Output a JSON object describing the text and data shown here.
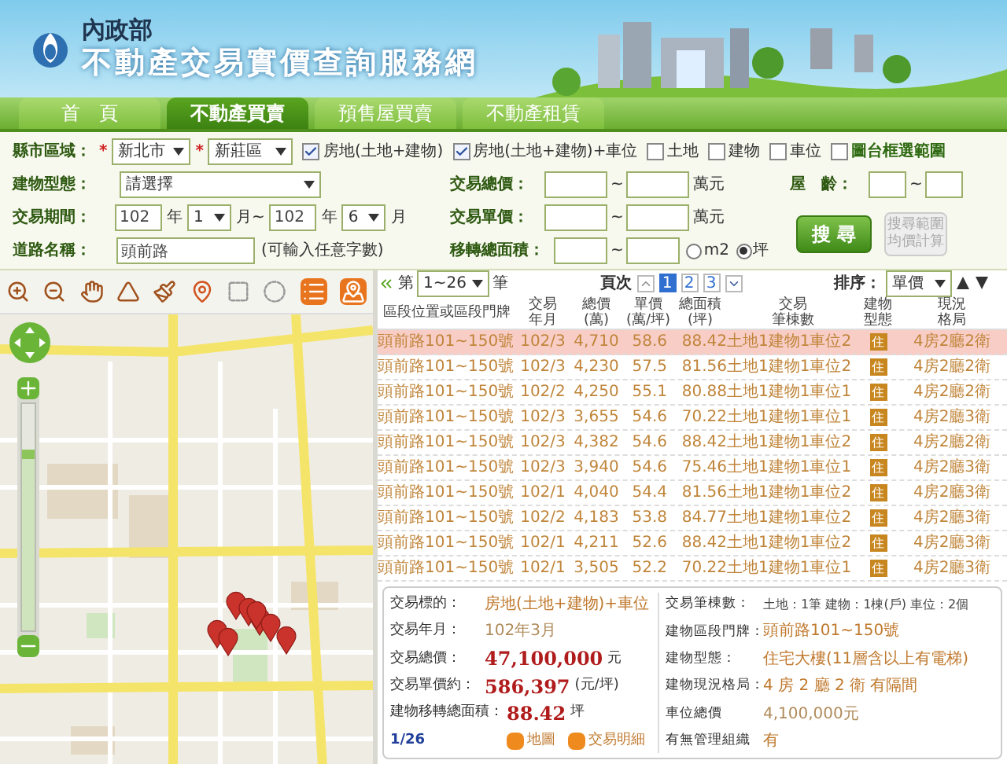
{
  "header": {
    "ministry": "內政部",
    "site_title": "不動產交易實價查詢服務網"
  },
  "tabs": [
    {
      "label": "首　頁",
      "selected": false
    },
    {
      "label": "不動產買賣",
      "selected": true
    },
    {
      "label": "預售屋買賣",
      "selected": false
    },
    {
      "label": "不動產租賃",
      "selected": false
    }
  ],
  "search_form": {
    "region": {
      "label": "縣市區域：",
      "required_mark": "*",
      "city": "新北市",
      "district_required_mark": "*",
      "district": "新莊區"
    },
    "type_filters": [
      {
        "label": "房地(土地+建物)",
        "checked": true,
        "kind": "type"
      },
      {
        "label": "房地(土地+建物)+車位",
        "checked": true,
        "kind": "type"
      },
      {
        "label": "土地",
        "checked": false,
        "kind": "type"
      },
      {
        "label": "建物",
        "checked": false,
        "kind": "type"
      },
      {
        "label": "車位",
        "checked": false,
        "kind": "type"
      },
      {
        "label": "圖台框選範圍",
        "checked": false,
        "kind": "map"
      }
    ],
    "building_type": {
      "label": "建物型態：",
      "value": "請選擇"
    },
    "total_price": {
      "label": "交易總價：",
      "separator": "~",
      "unit": "萬元"
    },
    "age": {
      "label": "屋　齡：",
      "separator": "~"
    },
    "period": {
      "label": "交易期間：",
      "from_year": "102",
      "from_year_unit": "年",
      "from_month": "1",
      "from_month_unit": "月~",
      "to_year": "102",
      "to_year_unit": "年",
      "to_month": "6",
      "to_month_unit": "月"
    },
    "unit_price": {
      "label": "交易單價：",
      "separator": "~",
      "unit": "萬元"
    },
    "road": {
      "label": "道路名稱：",
      "value": "頭前路",
      "hint": "(可輸入任意字數)"
    },
    "area": {
      "label": "移轉總面積：",
      "separator": "~",
      "units": [
        {
          "label": "m2",
          "selected": false
        },
        {
          "label": "坪",
          "selected": true
        }
      ]
    },
    "search_button": "搜 尋",
    "average_button": {
      "label": "搜尋範圍均價計算",
      "disabled": true
    }
  },
  "map": {
    "level": 0.8
  },
  "list": {
    "range_prefix": "第",
    "range": "1~26",
    "range_suffix": "筆",
    "pages_label": "頁次",
    "pages": [
      {
        "label": "1",
        "selected": true
      },
      {
        "label": "2",
        "selected": false
      },
      {
        "label": "3",
        "selected": false
      }
    ],
    "sort_label": "排序：",
    "sort": "單價",
    "columns": [
      [
        "區段位置或區段門牌"
      ],
      [
        "交易",
        "年月"
      ],
      [
        "總價",
        "(萬)"
      ],
      [
        "單價",
        "(萬/坪)"
      ],
      [
        "總面積",
        "(坪)"
      ],
      [
        "交易",
        "筆棟數"
      ],
      [
        "建物",
        "型態"
      ],
      [
        "現況",
        "格局"
      ]
    ],
    "rows": [
      {
        "address": "頭前路101~150號",
        "date": "102/3",
        "total": "4,710",
        "unit_price": "58.6",
        "area": "88.42",
        "counts": "土地1建物1車位2",
        "type": "住",
        "layout": "4房2廳2衛",
        "selected": true
      },
      {
        "address": "頭前路101~150號",
        "date": "102/3",
        "total": "4,230",
        "unit_price": "57.5",
        "area": "81.56",
        "counts": "土地1建物1車位2",
        "type": "住",
        "layout": "4房2廳2衛",
        "selected": false
      },
      {
        "address": "頭前路101~150號",
        "date": "102/2",
        "total": "4,250",
        "unit_price": "55.1",
        "area": "80.88",
        "counts": "土地1建物1車位1",
        "type": "住",
        "layout": "4房2廳2衛",
        "selected": false
      },
      {
        "address": "頭前路101~150號",
        "date": "102/3",
        "total": "3,655",
        "unit_price": "54.6",
        "area": "70.22",
        "counts": "土地1建物1車位1",
        "type": "住",
        "layout": "4房2廳3衛",
        "selected": false
      },
      {
        "address": "頭前路101~150號",
        "date": "102/3",
        "total": "4,382",
        "unit_price": "54.6",
        "area": "88.42",
        "counts": "土地1建物1車位2",
        "type": "住",
        "layout": "4房2廳2衛",
        "selected": false
      },
      {
        "address": "頭前路101~150號",
        "date": "102/3",
        "total": "3,940",
        "unit_price": "54.6",
        "area": "75.46",
        "counts": "土地1建物1車位1",
        "type": "住",
        "layout": "4房2廳3衛",
        "selected": false
      },
      {
        "address": "頭前路101~150號",
        "date": "102/1",
        "total": "4,040",
        "unit_price": "54.4",
        "area": "81.56",
        "counts": "土地1建物1車位2",
        "type": "住",
        "layout": "4房2廳3衛",
        "selected": false
      },
      {
        "address": "頭前路101~150號",
        "date": "102/2",
        "total": "4,183",
        "unit_price": "53.8",
        "area": "84.77",
        "counts": "土地1建物1車位2",
        "type": "住",
        "layout": "4房2廳3衛",
        "selected": false
      },
      {
        "address": "頭前路101~150號",
        "date": "102/1",
        "total": "4,211",
        "unit_price": "52.6",
        "area": "88.42",
        "counts": "土地1建物1車位2",
        "type": "住",
        "layout": "4房2廳3衛",
        "selected": false
      },
      {
        "address": "頭前路101~150號",
        "date": "102/1",
        "total": "3,505",
        "unit_price": "52.2",
        "area": "70.22",
        "counts": "土地1建物1車位1",
        "type": "住",
        "layout": "4房2廳3衛",
        "selected": false
      }
    ]
  },
  "detail": {
    "left": [
      {
        "label": "交易標的：",
        "value": "房地(土地+建物)+車位",
        "kind": "accent"
      },
      {
        "label": "交易年月：",
        "value": "102年3月",
        "kind": "muted"
      },
      {
        "label": "交易總價：",
        "value": "47,100,000",
        "unit": "元",
        "kind": "price"
      },
      {
        "label": "交易單價約：",
        "value": "586,397",
        "unit": "(元/坪)",
        "kind": "price"
      },
      {
        "label": "建物移轉總面積：",
        "value": "88.42",
        "unit": "坪",
        "kind": "price"
      }
    ],
    "page": "1/26",
    "links": [
      "地圖",
      "交易明細"
    ],
    "right": [
      {
        "label": "交易筆棟數：",
        "value": "土地：1筆 建物：1棟(戶) 車位：2個",
        "kind": "plain"
      },
      {
        "label": "建物區段門牌：",
        "value": "頭前路101~150號",
        "kind": "accent"
      },
      {
        "label": "建物型態：",
        "value": "住宅大樓(11層含以上有電梯)",
        "kind": "accent"
      },
      {
        "label": "建物現況格局：",
        "value": "4 房 2 廳 2 衛 有隔間",
        "kind": "accent"
      },
      {
        "label": "車位總價",
        "value": "4,100,000元",
        "kind": "muted"
      },
      {
        "label": "有無管理組織",
        "value": "有",
        "kind": "accent"
      }
    ]
  }
}
